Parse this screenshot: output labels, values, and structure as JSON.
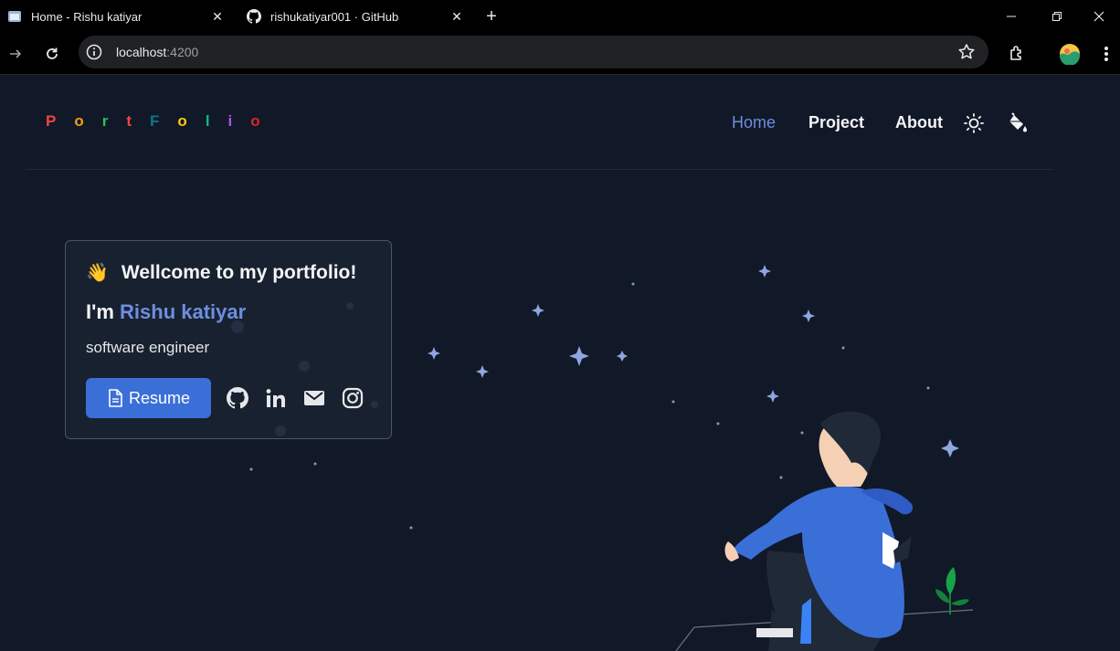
{
  "browser": {
    "tabs": [
      {
        "title": "Home - Rishu katiyar",
        "active": true
      },
      {
        "title": "rishukatiyar001 · GitHub",
        "active": false
      }
    ],
    "address": {
      "host": "localhost",
      "port": ":4200"
    }
  },
  "site": {
    "logo_letters": [
      {
        "char": "P",
        "color": "#ef4444"
      },
      {
        "char": "o",
        "color": "#f59e0b"
      },
      {
        "char": "r",
        "color": "#22c55e"
      },
      {
        "char": "t",
        "color": "#ef4444"
      },
      {
        "char": "F",
        "color": "#0e7490"
      },
      {
        "char": "o",
        "color": "#facc15"
      },
      {
        "char": "l",
        "color": "#10b981"
      },
      {
        "char": "i",
        "color": "#a855f7"
      },
      {
        "char": "o",
        "color": "#dc2626"
      }
    ],
    "nav": {
      "home": "Home",
      "project": "Project",
      "about": "About",
      "active_color": "#6d8ee0"
    }
  },
  "hero": {
    "wave": "👋",
    "welcome": "Wellcome to my portfolio!",
    "im_prefix": "I'm",
    "name": "Rishu katiyar",
    "role": "software engineer",
    "resume_label": "Resume",
    "social_icons": [
      "github-icon",
      "linkedin-icon",
      "mail-icon",
      "instagram-icon"
    ]
  },
  "colors": {
    "background": "#111827",
    "accent": "#3b6fd8"
  }
}
